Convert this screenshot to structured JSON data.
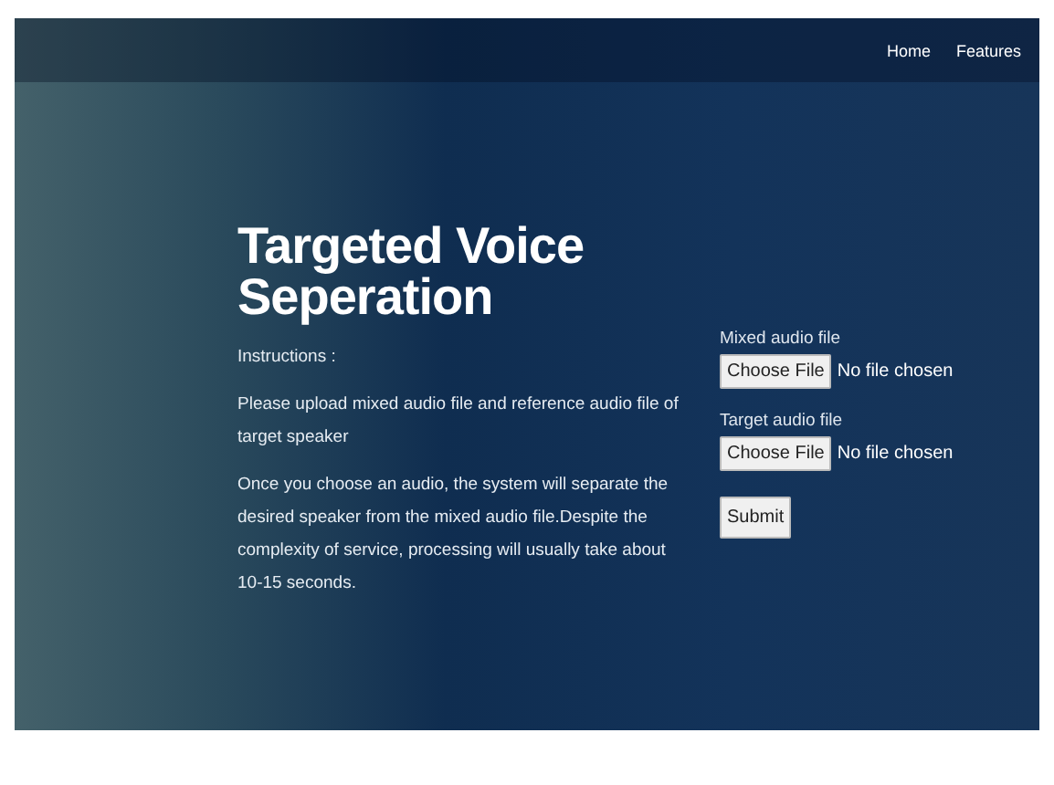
{
  "nav": {
    "links": [
      "Home",
      "Features"
    ]
  },
  "title": "Targeted Voice Seperation",
  "instructions_label": "Instructions :",
  "paragraphs": [
    "Please upload mixed audio file and reference audio file of target speaker",
    "Once you choose an audio, the system will separate the desired speaker from the mixed audio file.Despite the complexity of service, processing will usually take about 10-15 seconds."
  ],
  "uploads": [
    {
      "label": "Mixed audio file",
      "button": "Choose File",
      "status": "No file chosen"
    },
    {
      "label": "Target audio file",
      "button": "Choose File",
      "status": "No file chosen"
    }
  ],
  "submit": "Submit"
}
